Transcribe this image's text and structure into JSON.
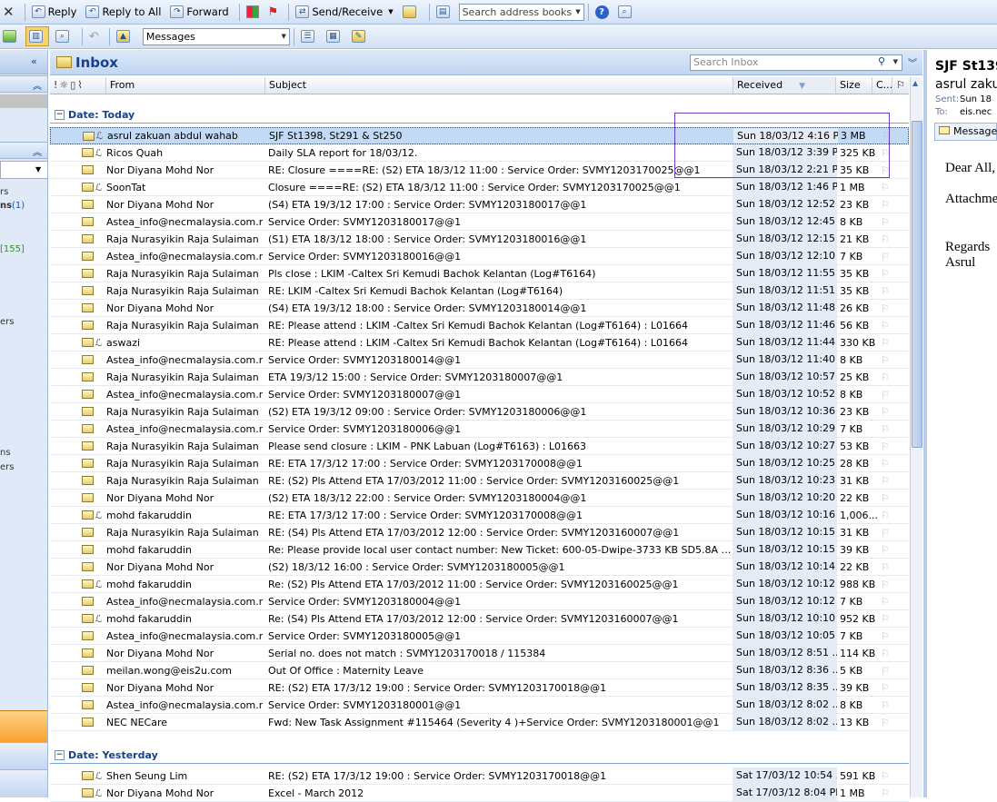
{
  "toolbar1": {
    "reply": "Reply",
    "reply_all": "Reply to All",
    "forward": "Forward",
    "send_receive": "Send/Receive",
    "search_address": "Search address books"
  },
  "toolbar2": {
    "folder_select": "Messages"
  },
  "inbox": {
    "title": "Inbox",
    "search_placeholder": "Search Inbox"
  },
  "columns": {
    "from": "From",
    "subject": "Subject",
    "received": "Received",
    "size": "Size",
    "categories": "C..."
  },
  "nav_fragments": [
    "rs",
    "ns",
    "(1)",
    "[155]",
    "ers",
    "ns",
    "ers"
  ],
  "groups": [
    {
      "label": "Date: Today",
      "rows": [
        {
          "from": "asrul zakuan abdul wahab",
          "subject": "SJF St1398, St291 & St250",
          "received": "Sun 18/03/12 4:16 P...",
          "size": "3 MB",
          "attach": true,
          "selected": true
        },
        {
          "from": "Ricos Quah",
          "subject": "Daily SLA report for 18/03/12.",
          "received": "Sun 18/03/12 3:39 P...",
          "size": "325 KB",
          "attach": true
        },
        {
          "from": "Nor Diyana Mohd Nor",
          "subject": "RE: Closure ====RE: (S2) ETA 18/3/12 11:00 : Service Order: SVMY1203170025@@1",
          "received": "Sun 18/03/12 2:21 P...",
          "size": "35 KB",
          "attach": false
        },
        {
          "from": "SoonTat",
          "subject": "Closure ====RE: (S2) ETA 18/3/12 11:00 : Service Order: SVMY1203170025@@1",
          "received": "Sun 18/03/12 1:46 P...",
          "size": "1 MB",
          "attach": true
        },
        {
          "from": "Nor Diyana Mohd Nor",
          "subject": "(S4) ETA 19/3/12 17:00 : Service Order: SVMY1203180017@@1",
          "received": "Sun 18/03/12 12:52 ...",
          "size": "23 KB",
          "attach": false
        },
        {
          "from": "Astea_info@necmalaysia.com.my",
          "subject": "Service Order: SVMY1203180017@@1",
          "received": "Sun 18/03/12 12:45 ...",
          "size": "8 KB",
          "attach": false
        },
        {
          "from": "Raja Nurasyikin Raja Sulaiman",
          "subject": "(S1) ETA 18/3/12 18:00 : Service Order: SVMY1203180016@@1",
          "received": "Sun 18/03/12 12:15 ...",
          "size": "21 KB",
          "attach": false
        },
        {
          "from": "Astea_info@necmalaysia.com.my",
          "subject": "Service Order: SVMY1203180016@@1",
          "received": "Sun 18/03/12 12:10 ...",
          "size": "7 KB",
          "attach": false
        },
        {
          "from": "Raja Nurasyikin Raja Sulaiman",
          "subject": "Pls close :  LKIM -Caltex Sri Kemudi Bachok Kelantan (Log#T6164)",
          "received": "Sun 18/03/12 11:55 ...",
          "size": "35 KB",
          "attach": false
        },
        {
          "from": "Raja Nurasyikin Raja Sulaiman",
          "subject": "RE: LKIM -Caltex Sri Kemudi Bachok Kelantan (Log#T6164)",
          "received": "Sun 18/03/12 11:51 ...",
          "size": "35 KB",
          "attach": false
        },
        {
          "from": "Nor Diyana Mohd Nor",
          "subject": "(S4) ETA 19/3/12 18:00 : Service Order: SVMY1203180014@@1",
          "received": "Sun 18/03/12 11:48 ...",
          "size": "26 KB",
          "attach": false
        },
        {
          "from": "Raja Nurasyikin Raja Sulaiman",
          "subject": "RE: Please attend : LKIM -Caltex Sri Kemudi Bachok Kelantan (Log#T6164) : L01664",
          "received": "Sun 18/03/12 11:46 ...",
          "size": "56 KB",
          "attach": false
        },
        {
          "from": "aswazi",
          "subject": "RE: Please attend : LKIM -Caltex Sri Kemudi Bachok Kelantan (Log#T6164) : L01664",
          "received": "Sun 18/03/12 11:44 ...",
          "size": "330 KB",
          "attach": true
        },
        {
          "from": "Astea_info@necmalaysia.com.my",
          "subject": "Service Order: SVMY1203180014@@1",
          "received": "Sun 18/03/12 11:40 ...",
          "size": "8 KB",
          "attach": false
        },
        {
          "from": "Raja Nurasyikin Raja Sulaiman",
          "subject": "ETA 19/3/12 15:00 : Service Order: SVMY1203180007@@1",
          "received": "Sun 18/03/12 10:57 ...",
          "size": "25 KB",
          "attach": false
        },
        {
          "from": "Astea_info@necmalaysia.com.my",
          "subject": "Service Order: SVMY1203180007@@1",
          "received": "Sun 18/03/12 10:52 ...",
          "size": "8 KB",
          "attach": false
        },
        {
          "from": "Raja Nurasyikin Raja Sulaiman",
          "subject": "(S2) ETA 19/3/12 09:00 : Service Order: SVMY1203180006@@1",
          "received": "Sun 18/03/12 10:36 ...",
          "size": "23 KB",
          "attach": false
        },
        {
          "from": "Astea_info@necmalaysia.com.my",
          "subject": "Service Order: SVMY1203180006@@1",
          "received": "Sun 18/03/12 10:29 ...",
          "size": "7 KB",
          "attach": false
        },
        {
          "from": "Raja Nurasyikin Raja Sulaiman",
          "subject": "Please send closure  : LKIM - PNK Labuan  (Log#T6163) : L01663",
          "received": "Sun 18/03/12 10:27 ...",
          "size": "53 KB",
          "attach": false
        },
        {
          "from": "Raja Nurasyikin Raja Sulaiman",
          "subject": "RE: ETA 17/3/12 17:00 : Service Order: SVMY1203170008@@1",
          "received": "Sun 18/03/12 10:25 ...",
          "size": "28 KB",
          "attach": false
        },
        {
          "from": "Raja Nurasyikin Raja Sulaiman",
          "subject": "RE: (S2) Pls Attend ETA 17/03/2012 11:00 : Service Order: SVMY1203160025@@1",
          "received": "Sun 18/03/12 10:23 ...",
          "size": "31 KB",
          "attach": false
        },
        {
          "from": "Nor Diyana Mohd Nor",
          "subject": "(S2) ETA 18/3/12 22:00 : Service Order: SVMY1203180004@@1",
          "received": "Sun 18/03/12 10:20 ...",
          "size": "22 KB",
          "attach": false
        },
        {
          "from": "mohd fakaruddin",
          "subject": "RE: ETA 17/3/12 17:00 : Service Order: SVMY1203170008@@1",
          "received": "Sun 18/03/12 10:16 ...",
          "size": "1,006...",
          "attach": true
        },
        {
          "from": "Raja Nurasyikin Raja Sulaiman",
          "subject": "RE: (S4) Pls Attend ETA 17/03/2012 12:00 : Service Order: SVMY1203160007@@1",
          "received": "Sun 18/03/12 10:15 ...",
          "size": "31 KB",
          "attach": false
        },
        {
          "from": "mohd fakaruddin",
          "subject": "Re: Please provide local user contact number: New Ticket:  600-05-Dwipe-3733  KB  SD5.8A Disk Wi...",
          "received": "Sun 18/03/12 10:15 ...",
          "size": "39 KB",
          "attach": false
        },
        {
          "from": "Nor Diyana Mohd Nor",
          "subject": "(S2) 18/3/12 16:00 : Service Order: SVMY1203180005@@1",
          "received": "Sun 18/03/12 10:14 ...",
          "size": "22 KB",
          "attach": false
        },
        {
          "from": "mohd fakaruddin",
          "subject": "Re: (S2) Pls Attend ETA 17/03/2012 11:00 : Service Order: SVMY1203160025@@1",
          "received": "Sun 18/03/12 10:12 ...",
          "size": "988 KB",
          "attach": true
        },
        {
          "from": "Astea_info@necmalaysia.com.my",
          "subject": "Service Order: SVMY1203180004@@1",
          "received": "Sun 18/03/12 10:12 ...",
          "size": "7 KB",
          "attach": false
        },
        {
          "from": "mohd fakaruddin",
          "subject": "Re: (S4) Pls Attend ETA 17/03/2012 12:00 : Service Order: SVMY1203160007@@1",
          "received": "Sun 18/03/12 10:10 ...",
          "size": "952 KB",
          "attach": true
        },
        {
          "from": "Astea_info@necmalaysia.com.my",
          "subject": "Service Order: SVMY1203180005@@1",
          "received": "Sun 18/03/12 10:05 ...",
          "size": "7 KB",
          "attach": false
        },
        {
          "from": "Nor Diyana Mohd Nor",
          "subject": "Serial no. does not match : SVMY1203170018 / 115384",
          "received": "Sun 18/03/12 8:51 ...",
          "size": "114 KB",
          "attach": false
        },
        {
          "from": "meilan.wong@eis2u.com",
          "subject": "Out Of Office : Maternity Leave",
          "received": "Sun 18/03/12 8:36 ...",
          "size": "5 KB",
          "attach": false
        },
        {
          "from": "Nor Diyana Mohd Nor",
          "subject": "RE: (S2) ETA 17/3/12 19:00 : Service Order: SVMY1203170018@@1",
          "received": "Sun 18/03/12 8:35 ...",
          "size": "39 KB",
          "attach": false
        },
        {
          "from": "Astea_info@necmalaysia.com.my",
          "subject": "Service Order: SVMY1203180001@@1",
          "received": "Sun 18/03/12 8:02 ...",
          "size": "8 KB",
          "attach": false
        },
        {
          "from": "NEC NECare",
          "subject": "Fwd: New Task Assignment #115464 (Severity 4 )+Service Order: SVMY1203180001@@1",
          "received": "Sun 18/03/12 8:02 ...",
          "size": "13 KB",
          "attach": false
        }
      ]
    },
    {
      "label": "Date: Yesterday",
      "rows": [
        {
          "from": "Shen Seung Lim",
          "subject": "RE: (S2) ETA 17/3/12 19:00 : Service Order: SVMY1203170018@@1",
          "received": "Sat 17/03/12 10:54 ...",
          "size": "591 KB",
          "attach": true
        },
        {
          "from": "Nor Diyana Mohd Nor",
          "subject": "Excel - March 2012",
          "received": "Sat 17/03/12 8:04 PM",
          "size": "1 MB",
          "attach": true
        }
      ]
    }
  ],
  "reading": {
    "subject": "SJF St139",
    "from": "asrul zaku",
    "sent_label": "Sent:",
    "sent_value": "Sun 18",
    "to_label": "To:",
    "to_value": "eis.nec",
    "message_tab": "Message",
    "body_greeting": "Dear All,",
    "body_attach": "Attachme",
    "body_regards": "Regards",
    "body_sign": "Asrul"
  }
}
